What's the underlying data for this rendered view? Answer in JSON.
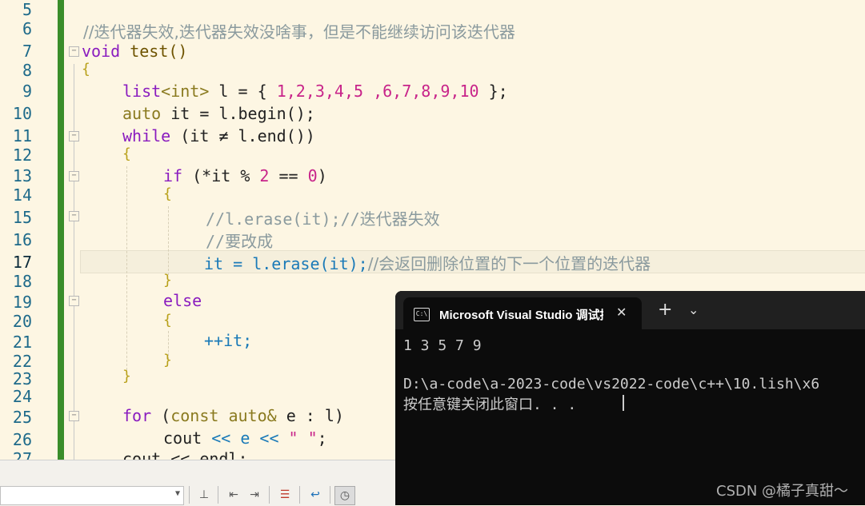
{
  "editor": {
    "line_numbers": [
      "5",
      "6",
      "7",
      "8",
      "9",
      "10",
      "11",
      "12",
      "13",
      "14",
      "15",
      "16",
      "17",
      "18",
      "19",
      "20",
      "21",
      "22",
      "23",
      "24",
      "25",
      "26",
      "27"
    ],
    "current_line": "17",
    "lines": {
      "l6_comment": "//迭代器失效,迭代器失效没啥事，但是不能继续访问该迭代器",
      "l7_void": "void",
      "l7_name": " test()",
      "l8_brace": "{",
      "l9_type": "list",
      "l9_tmpl": "<int>",
      "l9_rest": " l = { ",
      "l9_nums": "1,2,3,4,5 ,6,7,8,9,10",
      "l9_end": " };",
      "l10_kw": "auto",
      "l10_rest": " it = l.begin();",
      "l11_kw": "while",
      "l11_rest": " (it ≠ l.end())",
      "l12_brace": "{",
      "l13_kw": "if",
      "l13_rest": " (*it % ",
      "l13_n1": "2",
      "l13_mid": " == ",
      "l13_n2": "0",
      "l13_end": ")",
      "l14_brace": "{",
      "l15_comment": "//l.erase(it);//迭代器失效",
      "l16_comment": "//要改成",
      "l17_code": "it = l.erase(it);",
      "l17_comment": "//会返回删除位置的下一个位置的迭代器",
      "l18_brace": "}",
      "l19_kw": "else",
      "l20_brace": "{",
      "l21_code": "++it;",
      "l22_brace": "}",
      "l23_brace": "}",
      "l25_kw": "for",
      "l25_rest1": " (",
      "l25_kw2": "const auto&",
      "l25_rest2": " e : l)",
      "l26_code": "cout",
      "l26_rest": " << e << ",
      "l26_str": "\" \"",
      "l26_end": ";",
      "l27_partial": "cout << endl;"
    }
  },
  "console": {
    "tab_title": "Microsoft Visual Studio 调试控",
    "close_symbol": "✕",
    "new_tab_symbol": "+",
    "dropdown_symbol": "⌄",
    "output_line1": "1 3 5 7 9",
    "output_line2": "D:\\a-code\\a-2023-code\\vs2022-code\\c++\\10.lish\\x6",
    "output_line3": "按任意键关闭此窗口. . ."
  },
  "watermark": "CSDN @橘子真甜～",
  "colors": {
    "editor_bg": "#fdf6e3",
    "change_bar": "#3a8d2a",
    "console_bg": "#0c0c0c",
    "keyword": "#8a1cbf",
    "number": "#c8248a"
  }
}
